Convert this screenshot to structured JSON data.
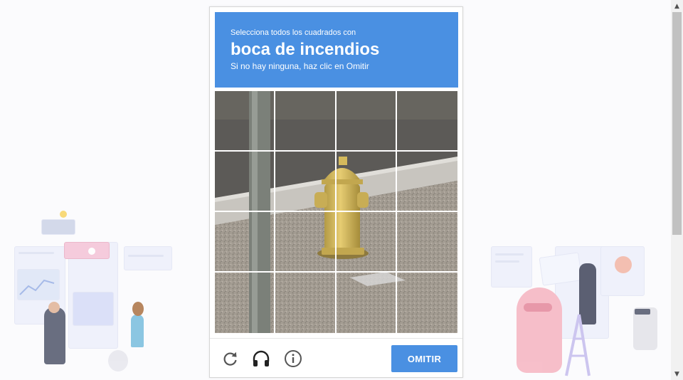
{
  "challenge": {
    "instruction": "Selecciona todos los cuadrados con",
    "target": "boca de incendios",
    "hint": "Si no hay ninguna, haz clic en Omitir"
  },
  "grid": {
    "rows": 4,
    "cols": 4
  },
  "footer": {
    "reload_icon": "reload-icon",
    "audio_icon": "headphones-icon",
    "info_icon": "info-icon",
    "skip_label": "OMITIR"
  },
  "colors": {
    "accent": "#4a90e2",
    "grid_line": "#ffffff"
  }
}
